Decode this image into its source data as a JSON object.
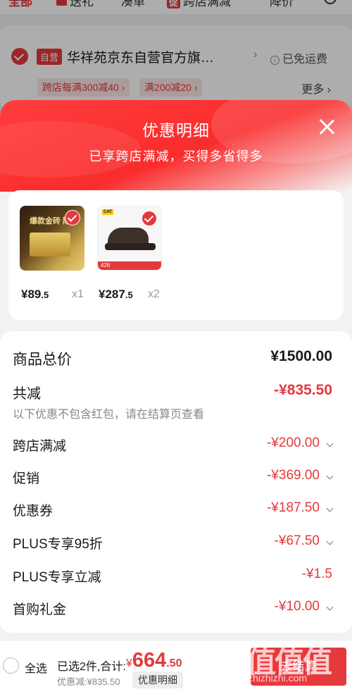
{
  "top_tabs": [
    {
      "label": "全部",
      "active": true
    },
    {
      "label": "送礼",
      "active": false
    },
    {
      "label": "凑单",
      "active": false
    },
    {
      "label": "跨店满减",
      "badge": "促",
      "active": false
    },
    {
      "label": "降价",
      "active": false
    }
  ],
  "shop": {
    "self_badge": "自营",
    "name": "华祥苑京东自营官方旗…",
    "shipping": "已免运费",
    "promos": [
      "跨店每满300减40 ›",
      "满200减20 ›"
    ],
    "more": "更多 ›"
  },
  "sheet": {
    "title": "优惠明细",
    "subtitle": "已享跨店满减，买得多省得多"
  },
  "products": [
    {
      "thumb_text": "爆款金砖 陈香",
      "price_int": "¥89",
      "price_dec": ".5",
      "qty": "x1"
    },
    {
      "thumb_logo": "CAT",
      "thumb_band": "426",
      "price_int": "¥287",
      "price_dec": ".5",
      "qty": "x2"
    }
  ],
  "summary": {
    "total_label": "商品总价",
    "total_value": "¥1500.00",
    "reduce_label": "共减",
    "reduce_value": "-¥835.50",
    "note": "以下优惠不包含红包，请在结算页查看",
    "items": [
      {
        "label": "跨店满减",
        "value": "-¥200.00"
      },
      {
        "label": "促销",
        "value": "-¥369.00"
      },
      {
        "label": "优惠券",
        "value": "-¥187.50"
      },
      {
        "label": "PLUS专享95折",
        "value": "-¥67.50"
      },
      {
        "label": "PLUS专享立减",
        "value": "-¥1.5"
      },
      {
        "label": "首购礼金",
        "value": "-¥10.00"
      }
    ]
  },
  "bottom": {
    "select_all": "全选",
    "selected": "已选2件,合计:",
    "currency": "¥",
    "total_int": "664",
    "total_dec": ".50",
    "discount": "优惠减:¥835.50",
    "detail_btn": "优惠明细",
    "checkout": "去结算"
  },
  "watermark": {
    "big": "值值值",
    "small": "zhizhizhi.com"
  },
  "colors": {
    "accent": "#e4393c",
    "header_red": "#fa2c2c"
  }
}
